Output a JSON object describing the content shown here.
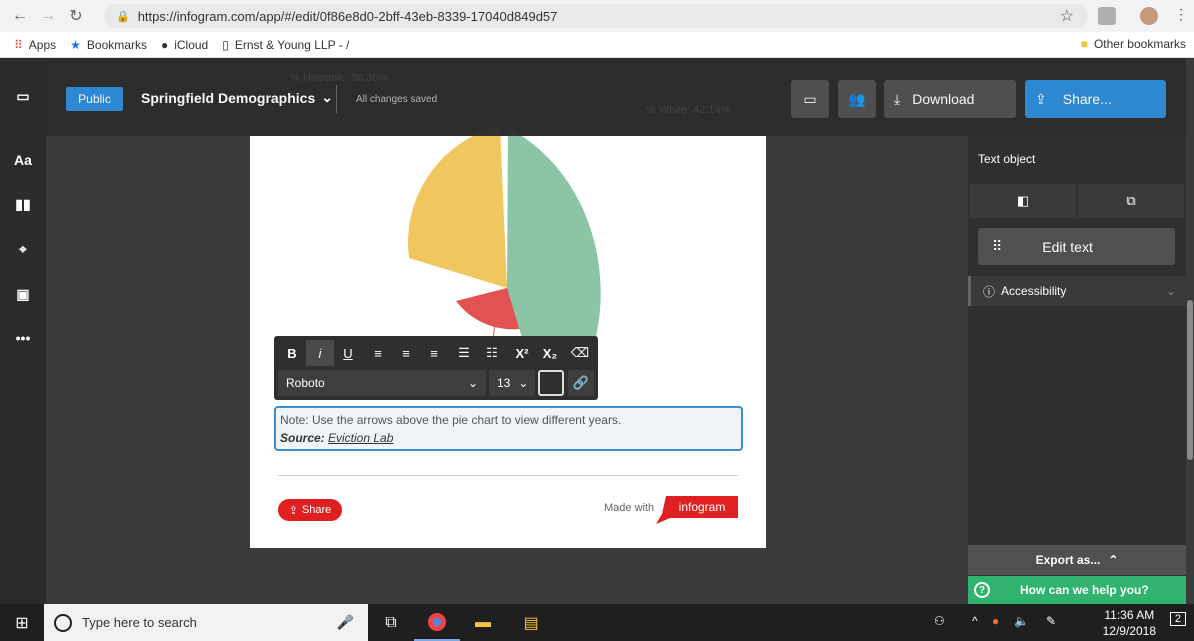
{
  "browser": {
    "url": "https://infogram.com/app/#/edit/0f86e8d0-2bff-43eb-8339-17040d849d57",
    "bookmarks": [
      "Apps",
      "Bookmarks",
      "iCloud",
      "Ernst & Young LLP - /"
    ],
    "other_bookmarks": "Other bookmarks"
  },
  "topbar": {
    "public_label": "Public",
    "doc_title": "Springfield Demographics",
    "saved_status": "All changes saved",
    "download_label": "Download",
    "share_label": "Share..."
  },
  "left_rail": [
    "Aa"
  ],
  "chart_labels": {
    "hidden_left": "% Hispanic: 38.30%",
    "hidden_right": "% White: 42.14%"
  },
  "text_toolbar": {
    "bold": "B",
    "italic": "i",
    "underline": "U",
    "superscript": "X²",
    "subscript": "X₂",
    "font": "Roboto",
    "size": "13"
  },
  "note": {
    "line1": "Note: Use the arrows above the pie chart to view different years.",
    "source_prefix": "Source: ",
    "source_link": "Eviction Lab"
  },
  "footer": {
    "share_label": "Share",
    "made_with": "Made with",
    "logo": "infogram"
  },
  "right_panel": {
    "title": "Text object",
    "edit_text": "Edit text",
    "accessibility": "Accessibility",
    "export": "Export as...",
    "help": "How can we help you?"
  },
  "taskbar": {
    "search_placeholder": "Type here to search",
    "time": "11:36 AM",
    "date": "12/9/2018",
    "notifications": "2"
  },
  "colors": {
    "accent_blue": "#2e8bd8",
    "pie_yellow": "#f0c75e",
    "pie_red": "#e05352",
    "pie_green": "#8cc5a5",
    "help_green": "#2fb36e"
  }
}
